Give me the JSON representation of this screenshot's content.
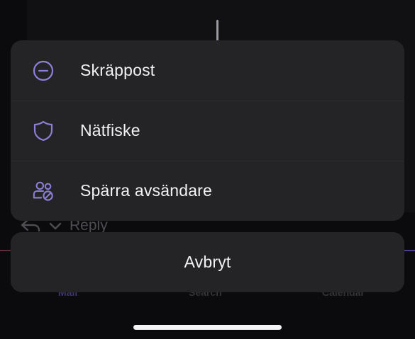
{
  "background": {
    "reply_label": "Reply",
    "tabs": {
      "mail": "Mail",
      "search": "Search",
      "calendar": "Calendar"
    }
  },
  "sheet": {
    "items": [
      {
        "label": "Skräppost",
        "icon": "minus-circle-icon"
      },
      {
        "label": "Nätfiske",
        "icon": "shield-icon"
      },
      {
        "label": "Spärra avsändare",
        "icon": "block-people-icon"
      }
    ],
    "cancel_label": "Avbryt"
  },
  "colors": {
    "accent_icon": "#8b7fd6",
    "sheet_background": "#242426",
    "text": "#f2f2f4"
  }
}
